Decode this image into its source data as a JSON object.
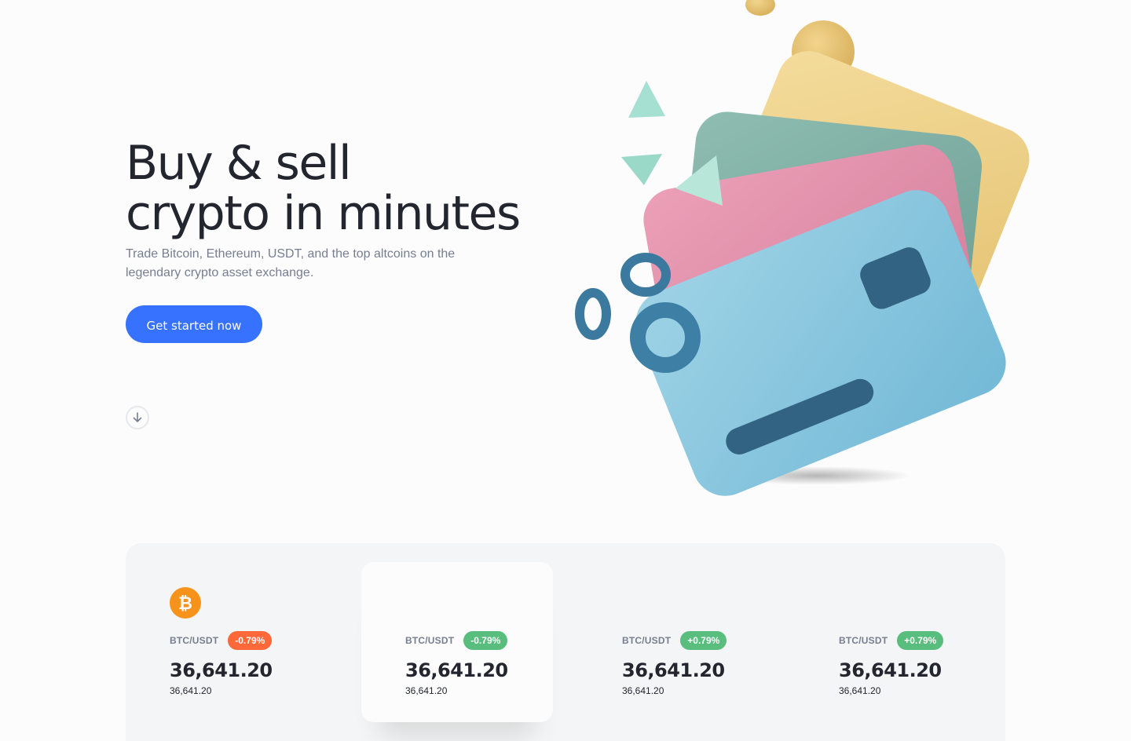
{
  "hero": {
    "title_line1": "Buy & sell",
    "title_line2": "crypto in minutes",
    "subtitle": "Trade Bitcoin, Ethereum, USDT, and the top altcoins on the legendary crypto asset exchange.",
    "cta_label": "Get started now",
    "scroll_icon": "arrow-down-icon"
  },
  "colors": {
    "accent": "#3772ff",
    "negative": "#ff6838",
    "positive": "#58bd7d",
    "bitcoin": "#f7931a"
  },
  "market": {
    "tickers": [
      {
        "pair": "BTC/USDT",
        "change": "-0.79%",
        "trend": "negative",
        "price": "36,641.20",
        "sub_price": "36,641.20",
        "icon": "bitcoin-icon"
      },
      {
        "pair": "BTC/USDT",
        "change": "-0.79%",
        "trend": "positive",
        "price": "36,641.20",
        "sub_price": "36,641.20"
      },
      {
        "pair": "BTC/USDT",
        "change": "+0.79%",
        "trend": "positive",
        "price": "36,641.20",
        "sub_price": "36,641.20"
      },
      {
        "pair": "BTC/USDT",
        "change": "+0.79%",
        "trend": "positive",
        "price": "36,641.20",
        "sub_price": "36,641.20"
      }
    ]
  }
}
